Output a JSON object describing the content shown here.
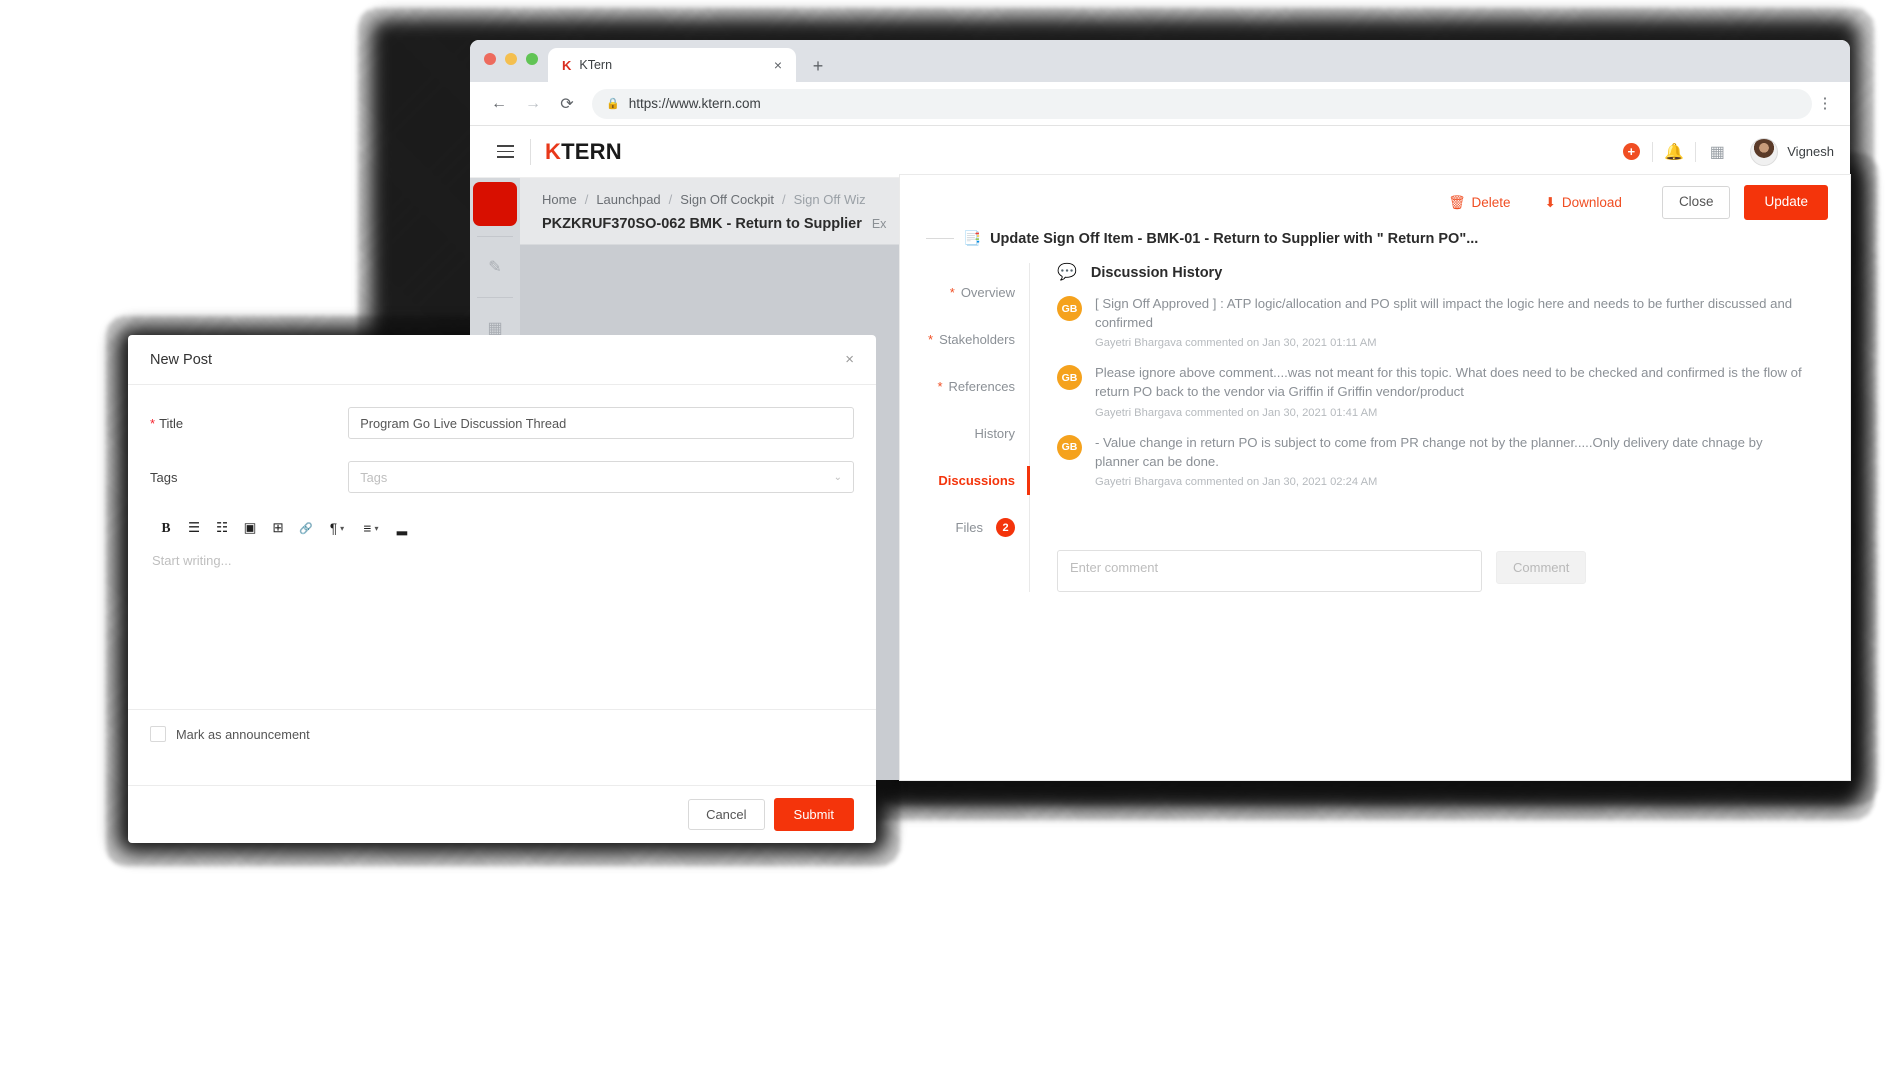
{
  "browser": {
    "tab_title": "KTern",
    "tab_favicon": "K",
    "tab_close_icon": "×",
    "new_tab_icon": "+",
    "back_icon": "←",
    "forward_icon": "→",
    "reload_icon": "⟳",
    "lock_icon": "🔒",
    "url": "https://www.ktern.com",
    "menu_icon": "⋮"
  },
  "app_header": {
    "brand_k": "K",
    "brand_rest": "TERN",
    "add_icon": "+",
    "bell_icon": "🔔",
    "calendar_icon": "▦",
    "username": "Vignesh"
  },
  "left_rail": {
    "edit_icon": "✎",
    "apps_icon": "▦"
  },
  "breadcrumb": {
    "items": [
      "Home",
      "Launchpad",
      "Sign Off Cockpit",
      "Sign Off Wiz"
    ],
    "separator": "/",
    "page_title": "PKZKRUF370SO-062 BMK - Return to Supplier",
    "page_subtitle": "Ex"
  },
  "detail_panel": {
    "delete_label": "Delete",
    "delete_icon": "🗑",
    "download_label": "Download",
    "download_icon": "⬇",
    "close_label": "Close",
    "update_label": "Update",
    "title_icon": "📑",
    "title": "Update Sign Off Item - BMK-01 - Return to Supplier with \" Return PO\"...",
    "nav": [
      {
        "label": "Overview",
        "required": true,
        "active": false
      },
      {
        "label": "Stakeholders",
        "required": true,
        "active": false
      },
      {
        "label": "References",
        "required": true,
        "active": false
      },
      {
        "label": "History",
        "required": false,
        "active": false
      },
      {
        "label": "Discussions",
        "required": false,
        "active": true
      },
      {
        "label": "Files",
        "required": false,
        "active": false,
        "badge": "2"
      }
    ],
    "discussion": {
      "heading": "Discussion History",
      "heading_icon": "💬",
      "comments": [
        {
          "initials": "GB",
          "text": "[ Sign Off Approved ] : ATP logic/allocation and PO split will impact the logic here and needs to be further discussed and confirmed",
          "meta": "Gayetri Bhargava commented on Jan 30, 2021 01:11 AM"
        },
        {
          "initials": "GB",
          "text": "Please ignore above comment....was not meant for this topic. What does need to be checked and confirmed is the flow of return PO back to the vendor via Griffin if Griffin vendor/product",
          "meta": "Gayetri Bhargava commented on Jan 30, 2021 01:41 AM"
        },
        {
          "initials": "GB",
          "text": "- Value change in return PO is subject to come from PR change not by the planner.....Only delivery date chnage by planner can be done.",
          "meta": "Gayetri Bhargava commented on Jan 30, 2021 02:24 AM"
        }
      ],
      "comment_placeholder": "Enter comment",
      "comment_value": "",
      "comment_button": "Comment"
    }
  },
  "new_post_modal": {
    "title": "New Post",
    "close_icon": "×",
    "title_label": "Title",
    "title_value": "Program Go Live Discussion Thread",
    "title_placeholder": "Title",
    "tags_label": "Tags",
    "tags_placeholder": "Tags",
    "tags_caret": "⌄",
    "toolbar": [
      {
        "name": "bold-icon",
        "glyph": "B"
      },
      {
        "name": "bullet-list-icon",
        "glyph": "☰"
      },
      {
        "name": "numbered-list-icon",
        "glyph": "☷"
      },
      {
        "name": "image-icon",
        "glyph": "▣"
      },
      {
        "name": "table-icon",
        "glyph": "⊞"
      },
      {
        "name": "link-icon",
        "glyph": "🔗"
      },
      {
        "name": "paragraph-style-icon",
        "glyph": "¶"
      },
      {
        "name": "align-icon",
        "glyph": "≡"
      },
      {
        "name": "horizontal-rule-icon",
        "glyph": "▂"
      }
    ],
    "editor_placeholder": "Start writing...",
    "announcement_label": "Mark as announcement",
    "cancel_label": "Cancel",
    "submit_label": "Submit"
  },
  "colors": {
    "accent": "#f4340b",
    "brand_red": "#e8381a",
    "avatar_orange": "#f5a21d",
    "rail_red": "#d80f00"
  }
}
